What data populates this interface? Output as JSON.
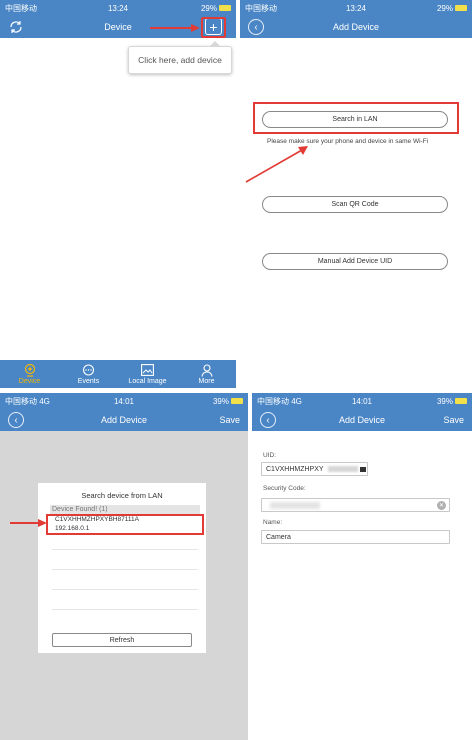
{
  "colors": {
    "nav_blue": "#4a86c5",
    "annotation_red": "#e23b35",
    "active_tab": "#f2b705"
  },
  "panel1": {
    "status": {
      "carrier": "中国移动",
      "time": "13:24",
      "right": "29%"
    },
    "title": "Device",
    "left_icon": "refresh-icon",
    "right_icon": "plus-icon",
    "tooltip": "Click here, add device",
    "tabs": [
      {
        "label": "Device",
        "icon": "camera-icon",
        "active": true
      },
      {
        "label": "Events",
        "icon": "chat-icon",
        "active": false
      },
      {
        "label": "Local Image",
        "icon": "image-icon",
        "active": false
      },
      {
        "label": "More",
        "icon": "person-icon",
        "active": false
      }
    ]
  },
  "panel2": {
    "status": {
      "carrier": "中国移动",
      "time": "13:24",
      "right": "29%"
    },
    "title": "Add Device",
    "search_lan": "Search in LAN",
    "hint": "Please make sure your phone and device in same Wi-Fi",
    "scan_qr": "Scan QR Code",
    "manual_uid": "Manual Add Device UID"
  },
  "panel3": {
    "status": {
      "carrier": "中国移动 4G",
      "time": "14:01",
      "right": "39%"
    },
    "title": "Add Device",
    "save": "Save",
    "dialog_title": "Search device from LAN",
    "found": "Device Found! (1)",
    "device_uid": "C1VXHHMZHPXYBH87111A",
    "device_ip": "192.168.0.1",
    "refresh": "Refresh"
  },
  "panel4": {
    "status": {
      "carrier": "中国移动 4G",
      "time": "14:01",
      "right": "39%"
    },
    "title": "Add Device",
    "save": "Save",
    "uid_label": "UID:",
    "uid_value": "C1VXHHMZHPXY",
    "security_label": "Security Code:",
    "name_label": "Name:",
    "name_value": "Camera"
  }
}
